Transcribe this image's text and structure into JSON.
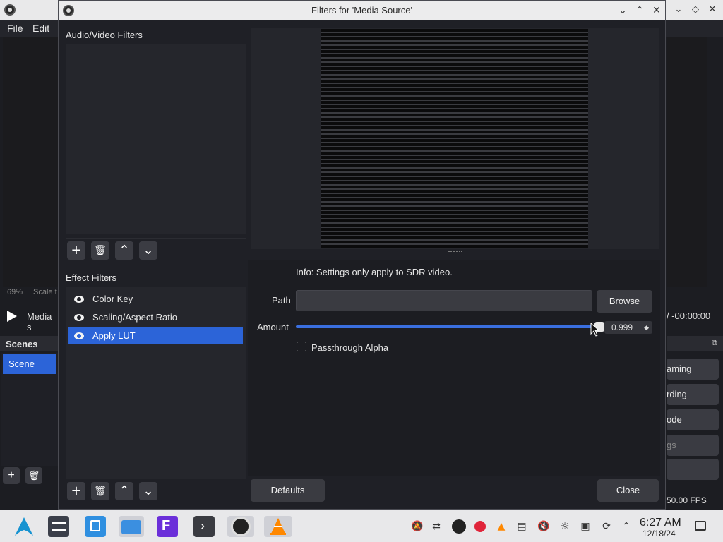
{
  "obs_main": {
    "menu": [
      {
        "label": "File"
      },
      {
        "label": "Edit"
      }
    ],
    "status_zoom": "69%",
    "status_scale": "Scale t",
    "media_label": "Media s",
    "timecode": "/ -00:00:00",
    "scenes_header": "Scenes",
    "scene_item": "Scene",
    "controls": [
      "aming",
      "rding",
      "ode",
      "gs",
      ""
    ],
    "fps": "50.00 FPS"
  },
  "dialog": {
    "title": "Filters for 'Media Source'",
    "av_filters_label": "Audio/Video Filters",
    "effect_filters_label": "Effect Filters",
    "effect_filters": [
      {
        "label": "Color Key",
        "visible": true,
        "selected": false
      },
      {
        "label": "Scaling/Aspect Ratio",
        "visible": true,
        "selected": false
      },
      {
        "label": "Apply LUT",
        "visible": true,
        "selected": true
      }
    ],
    "properties": {
      "info": "Info: Settings only apply to SDR video.",
      "path_label": "Path",
      "path_value": "",
      "browse_label": "Browse",
      "amount_label": "Amount",
      "amount_value": "0.999",
      "amount_fraction": 0.999,
      "passthrough_alpha_label": "Passthrough Alpha",
      "passthrough_alpha_checked": false
    },
    "defaults_label": "Defaults",
    "close_label": "Close"
  },
  "colors": {
    "accent": "#2c64d8",
    "dialog_bg": "#1f2026",
    "button_bg": "#3a3b41"
  },
  "taskbar": {
    "apps": [
      "arch-linux-menu-icon",
      "settings-sliders-icon",
      "software-store-icon",
      "file-manager-icon",
      "fl-app-icon",
      "terminal-icon",
      "obs-studio-icon",
      "vlc-icon"
    ],
    "tray": [
      "notifications-muted-icon",
      "network-share-icon",
      "obs-tray-icon",
      "record-icon",
      "vlc-tray-icon",
      "clipboard-icon",
      "volume-muted-icon",
      "brightness-icon",
      "storage-icon",
      "updates-icon",
      "expand-tray-icon"
    ],
    "time": "6:27 AM",
    "date": "12/18/24"
  }
}
